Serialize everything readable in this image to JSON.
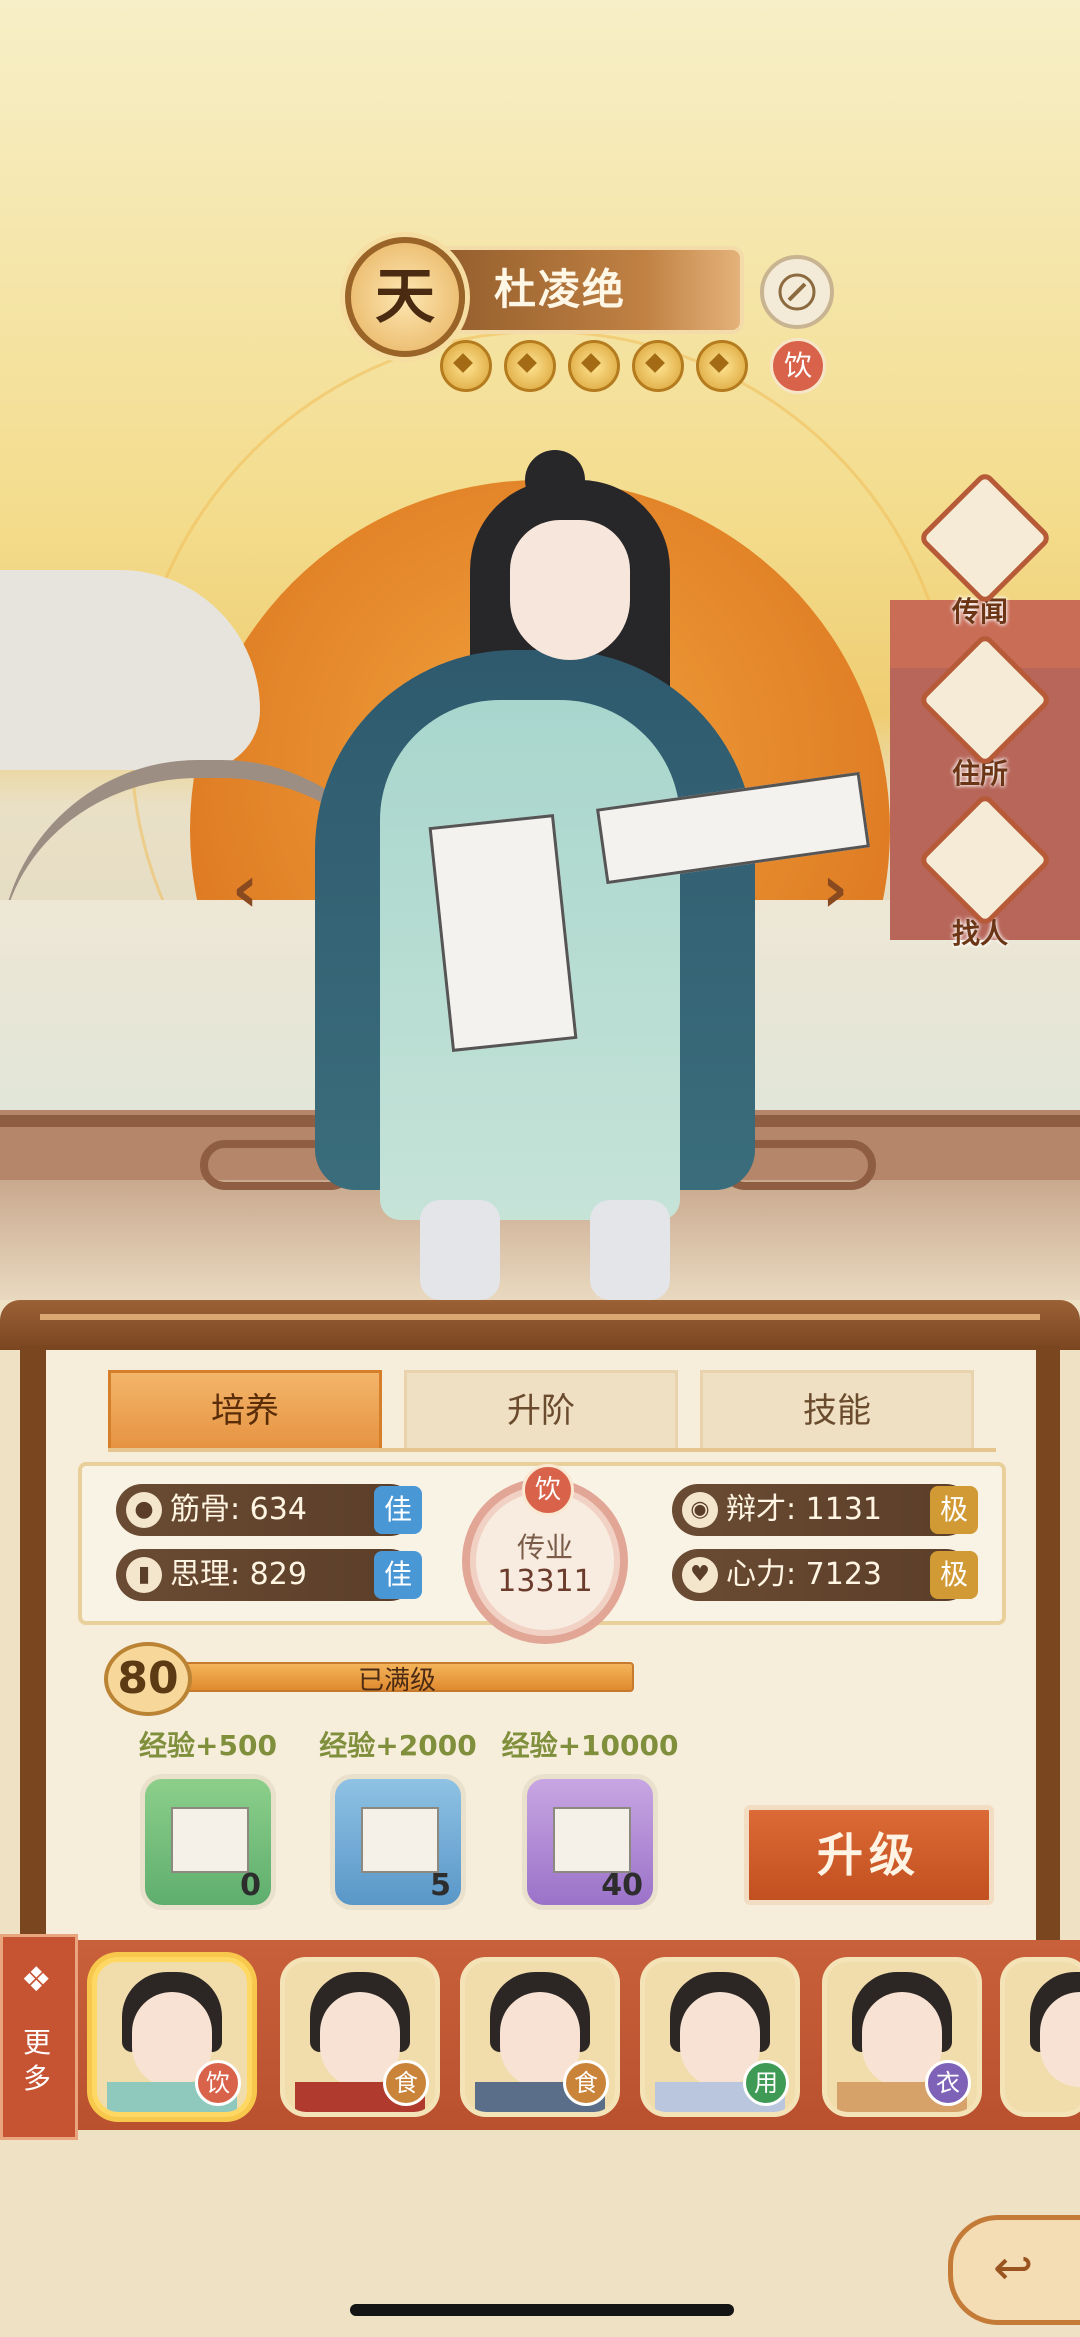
{
  "header": {
    "rank": "天",
    "name": "杜凌绝",
    "star_count": 5,
    "specialty_tag": "饮"
  },
  "side_menu": [
    {
      "label": "传闻",
      "icon": "scroll-icon"
    },
    {
      "label": "住所",
      "icon": "house-icon"
    },
    {
      "label": "找人",
      "icon": "search-person-icon"
    }
  ],
  "tabs": [
    "培养",
    "升阶",
    "技能"
  ],
  "active_tab": "培养",
  "stats": {
    "jingu": {
      "label": "筋骨: 634",
      "grade": "佳"
    },
    "sili": {
      "label": "思理: 829",
      "grade": "佳"
    },
    "biancai": {
      "label": "辩才: 1131",
      "grade": "极"
    },
    "xinli": {
      "label": "心力: 7123",
      "grade": "极"
    }
  },
  "profession": {
    "tag": "饮",
    "category": "传业",
    "value": "13311"
  },
  "level": {
    "value": "80",
    "status": "已满级",
    "progress": 1.0
  },
  "exp_items": [
    {
      "label": "经验+500",
      "count": "0",
      "color": "green"
    },
    {
      "label": "经验+2000",
      "count": "5",
      "color": "blue"
    },
    {
      "label": "经验+10000",
      "count": "40",
      "color": "purple"
    }
  ],
  "upgrade_label": "升级",
  "more_label": "更多",
  "roster": [
    {
      "tag": "饮",
      "tag_color": "#d9634a",
      "selected": true
    },
    {
      "tag": "食",
      "tag_color": "#c9843a",
      "selected": false
    },
    {
      "tag": "食",
      "tag_color": "#c9843a",
      "selected": false
    },
    {
      "tag": "用",
      "tag_color": "#3f9a55",
      "selected": false
    },
    {
      "tag": "衣",
      "tag_color": "#7e62b8",
      "selected": false
    }
  ]
}
